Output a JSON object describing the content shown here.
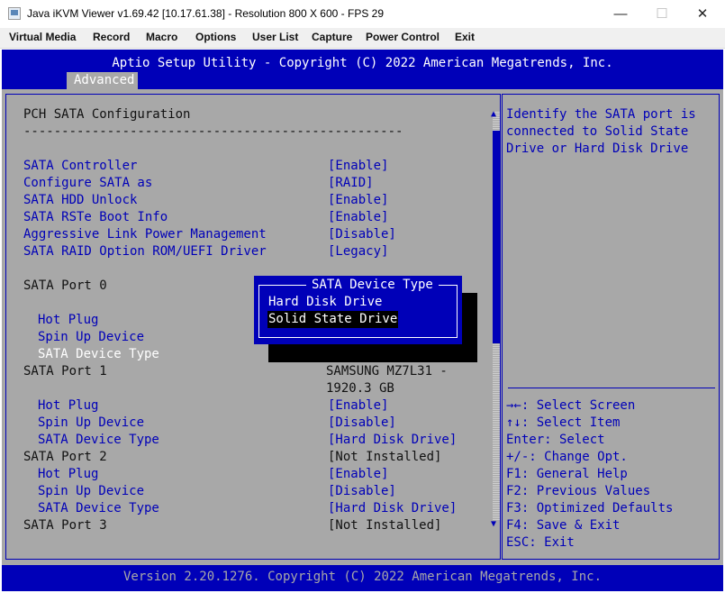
{
  "window": {
    "title": "Java iKVM Viewer v1.69.42 [10.17.61.38]  - Resolution 800 X 600 - FPS 29",
    "minimize_glyph": "—",
    "maximize_glyph": "☐",
    "close_glyph": "✕"
  },
  "menubar": [
    "Virtual Media",
    "Record",
    "Macro",
    "Options",
    "User List",
    "Capture",
    "Power Control",
    "Exit"
  ],
  "bios": {
    "header_title": "Aptio Setup Utility - Copyright (C) 2022 American Megatrends, Inc.",
    "active_tab": "Advanced",
    "page_title": "PCH SATA Configuration",
    "separator": "--------------------------------------------------",
    "settings": [
      {
        "label": "SATA Controller",
        "value": "[Enable]"
      },
      {
        "label": "Configure SATA as",
        "value": "[RAID]"
      },
      {
        "label": "SATA HDD Unlock",
        "value": "[Enable]"
      },
      {
        "label": "SATA RSTe Boot Info",
        "value": "[Enable]"
      },
      {
        "label": "Aggressive Link Power Management",
        "value": "[Disable]"
      },
      {
        "label": "SATA RAID Option ROM/UEFI Driver",
        "value": "[Legacy]"
      }
    ],
    "port0": {
      "label": "SATA Port 0",
      "hot_plug": "Hot Plug",
      "spin_up": "Spin Up Device",
      "device_type": "SATA Device Type"
    },
    "port1": {
      "label": "SATA Port 1",
      "value_line1": "SAMSUNG MZ7L31 -",
      "value_line2": "1920.3 GB",
      "hot_plug": "Hot Plug",
      "hot_plug_value": "[Enable]",
      "spin_up": "Spin Up Device",
      "spin_up_value": "[Disable]",
      "device_type": "SATA Device Type",
      "device_type_value": "[Hard Disk Drive]"
    },
    "port2": {
      "label": "SATA Port 2",
      "value": "[Not Installed]",
      "hot_plug": "Hot Plug",
      "hot_plug_value": "[Enable]",
      "spin_up": "Spin Up Device",
      "spin_up_value": "[Disable]",
      "device_type": "SATA Device Type",
      "device_type_value": "[Hard Disk Drive]"
    },
    "port3": {
      "label": "SATA Port 3",
      "value": "[Not Installed]"
    },
    "scroll_up_glyph": "▲",
    "scroll_down_glyph": "▼",
    "popup": {
      "title": "SATA Device Type",
      "options": [
        "Hard Disk Drive",
        "Solid State Drive"
      ],
      "selected": "Solid State Drive"
    },
    "help": {
      "lines": [
        "Identify the SATA port is",
        "connected to Solid State",
        "Drive or Hard Disk Drive"
      ]
    },
    "keys": [
      "→←: Select Screen",
      "↑↓: Select Item",
      "Enter: Select",
      "+/-: Change Opt.",
      "F1: General Help",
      "F2: Previous Values",
      "F3: Optimized Defaults",
      "F4: Save & Exit",
      "ESC: Exit"
    ],
    "footer": "Version 2.20.1276. Copyright (C) 2022 American Megatrends, Inc."
  },
  "colors": {
    "bios_blue": "#0000b8",
    "bios_gray": "#a8a8a8",
    "highlight": "#000000",
    "text_white": "#ffffff"
  }
}
